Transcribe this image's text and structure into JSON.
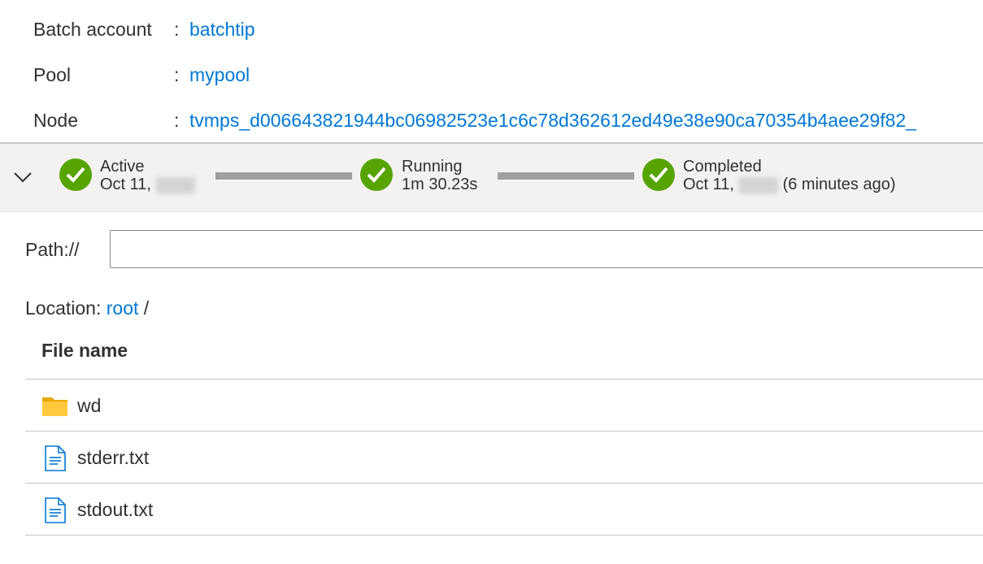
{
  "properties": {
    "batch_account": {
      "label": "Batch account",
      "colon": ":",
      "value": "batchtip"
    },
    "pool": {
      "label": "Pool",
      "colon": ":",
      "value": "mypool"
    },
    "node": {
      "label": "Node",
      "colon": ":",
      "value": "tvmps_d006643821944bc06982523e1c6c78d362612ed49e38e90ca70354b4aee29f82_"
    }
  },
  "status": {
    "steps": [
      {
        "title": "Active",
        "detail": "Oct 11,",
        "suffix": ""
      },
      {
        "title": "Running",
        "detail": "1m 30.23s",
        "suffix": ""
      },
      {
        "title": "Completed",
        "detail": "Oct 11,",
        "suffix": "(6 minutes ago)"
      }
    ],
    "success_color": "#57a300"
  },
  "path": {
    "label": "Path://",
    "value": "",
    "placeholder": ""
  },
  "location": {
    "label": "Location:",
    "root": "root",
    "separator": "/"
  },
  "files": {
    "header": "File name",
    "items": [
      {
        "name": "wd",
        "icon": "folder-icon"
      },
      {
        "name": "stderr.txt",
        "icon": "text-file-icon"
      },
      {
        "name": "stdout.txt",
        "icon": "text-file-icon"
      }
    ]
  },
  "colors": {
    "link": "#0078d4",
    "bar_background": "#f3f2f1",
    "folder": "#ffc83d"
  }
}
